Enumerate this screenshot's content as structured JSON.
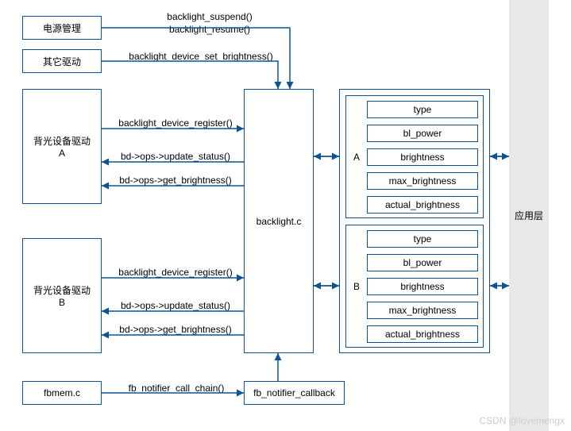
{
  "boxes": {
    "power_mgmt": "电源管理",
    "other_driver": "其它驱动",
    "backlight_drv_a": "背光设备驱动\nA",
    "backlight_drv_b": "背光设备驱动\nB",
    "fbmem": "fbmem.c",
    "backlight_c": "backlight.c",
    "fb_notifier_cb": "fb_notifier_callback",
    "dev_a_label": "A",
    "dev_b_label": "B",
    "app_layer": "应用层"
  },
  "attrs": {
    "type": "type",
    "bl_power": "bl_power",
    "brightness": "brightness",
    "max_brightness": "max_brightness",
    "actual_brightness": "actual_brightness"
  },
  "arrows": {
    "backlight_suspend": "backlight_suspend()",
    "backlight_resume": "backlight_resume()",
    "set_brightness": "backlight_device_set_brightness()",
    "register": "backlight_device_register()",
    "update_status": "bd->ops->update_status()",
    "get_brightness": "bd->ops->get_brightness()",
    "fb_notifier_chain": "fb_notifier_call_chain()"
  },
  "watermark": "CSDN @lovemengx"
}
